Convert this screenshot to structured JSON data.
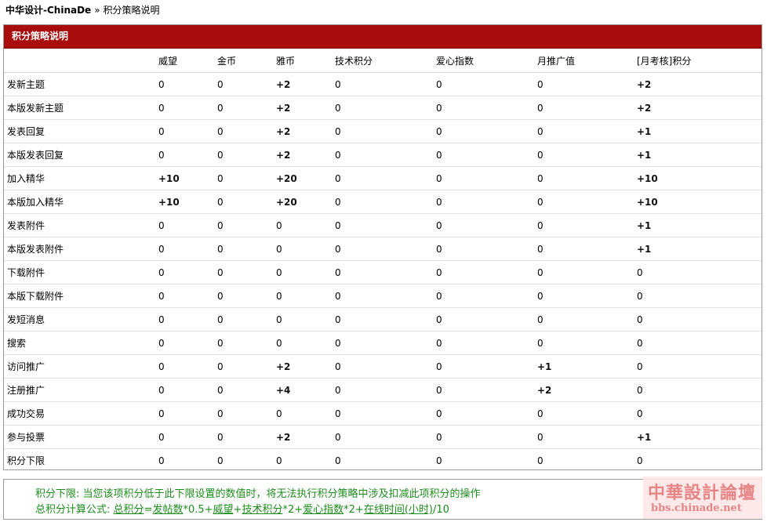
{
  "breadcrumb": {
    "site": "中华设计-ChinaDe",
    "separator": "»",
    "current": "积分策略说明"
  },
  "panel": {
    "title": "积分策略说明",
    "columns": [
      "",
      "威望",
      "金币",
      "雅币",
      "技术积分",
      "爱心指数",
      "月推广值",
      "[月考核]积分"
    ],
    "rows": [
      {
        "name": "发新主题",
        "values": [
          "0",
          "0",
          "+2",
          "0",
          "0",
          "0",
          "+2"
        ]
      },
      {
        "name": "本版发新主题",
        "values": [
          "0",
          "0",
          "+2",
          "0",
          "0",
          "0",
          "+2"
        ]
      },
      {
        "name": "发表回复",
        "values": [
          "0",
          "0",
          "+2",
          "0",
          "0",
          "0",
          "+1"
        ]
      },
      {
        "name": "本版发表回复",
        "values": [
          "0",
          "0",
          "+2",
          "0",
          "0",
          "0",
          "+1"
        ]
      },
      {
        "name": "加入精华",
        "values": [
          "+10",
          "0",
          "+20",
          "0",
          "0",
          "0",
          "+10"
        ]
      },
      {
        "name": "本版加入精华",
        "values": [
          "+10",
          "0",
          "+20",
          "0",
          "0",
          "0",
          "+10"
        ]
      },
      {
        "name": "发表附件",
        "values": [
          "0",
          "0",
          "0",
          "0",
          "0",
          "0",
          "+1"
        ]
      },
      {
        "name": "本版发表附件",
        "values": [
          "0",
          "0",
          "0",
          "0",
          "0",
          "0",
          "+1"
        ]
      },
      {
        "name": "下载附件",
        "values": [
          "0",
          "0",
          "0",
          "0",
          "0",
          "0",
          "0"
        ]
      },
      {
        "name": "本版下载附件",
        "values": [
          "0",
          "0",
          "0",
          "0",
          "0",
          "0",
          "0"
        ]
      },
      {
        "name": "发短消息",
        "values": [
          "0",
          "0",
          "0",
          "0",
          "0",
          "0",
          "0"
        ]
      },
      {
        "name": "搜索",
        "values": [
          "0",
          "0",
          "0",
          "0",
          "0",
          "0",
          "0"
        ]
      },
      {
        "name": "访问推广",
        "values": [
          "0",
          "0",
          "+2",
          "0",
          "0",
          "+1",
          "0"
        ]
      },
      {
        "name": "注册推广",
        "values": [
          "0",
          "0",
          "+4",
          "0",
          "0",
          "+2",
          "0"
        ]
      },
      {
        "name": "成功交易",
        "values": [
          "0",
          "0",
          "0",
          "0",
          "0",
          "0",
          "0"
        ]
      },
      {
        "name": "参与投票",
        "values": [
          "0",
          "0",
          "+2",
          "0",
          "0",
          "0",
          "+1"
        ]
      },
      {
        "name": "积分下限",
        "values": [
          "0",
          "0",
          "0",
          "0",
          "0",
          "0",
          "0"
        ]
      }
    ]
  },
  "footer": {
    "line1": "积分下限: 当您该项积分低于此下限设置的数值时，将无法执行积分策略中涉及扣减此项积分的操作",
    "line2_prefix": "总积分计算公式: ",
    "f_total": "总积分",
    "f_eq": "=",
    "f_posts": "发帖数",
    "f_t1": "*0.5+",
    "f_prestige": "威望",
    "f_t2": "+",
    "f_tech": "技术积分",
    "f_t3": "*2+",
    "f_love": "爱心指数",
    "f_t4": "*2+",
    "f_online": "在线时间(小时)",
    "f_t5": "/10"
  },
  "logo": {
    "top": "中華設計論壇",
    "bottom": "bbs.chinade.net"
  },
  "colors": {
    "header": "#a80c0c",
    "footer_text": "#1d8c1d",
    "logo": "#e37b7b"
  }
}
